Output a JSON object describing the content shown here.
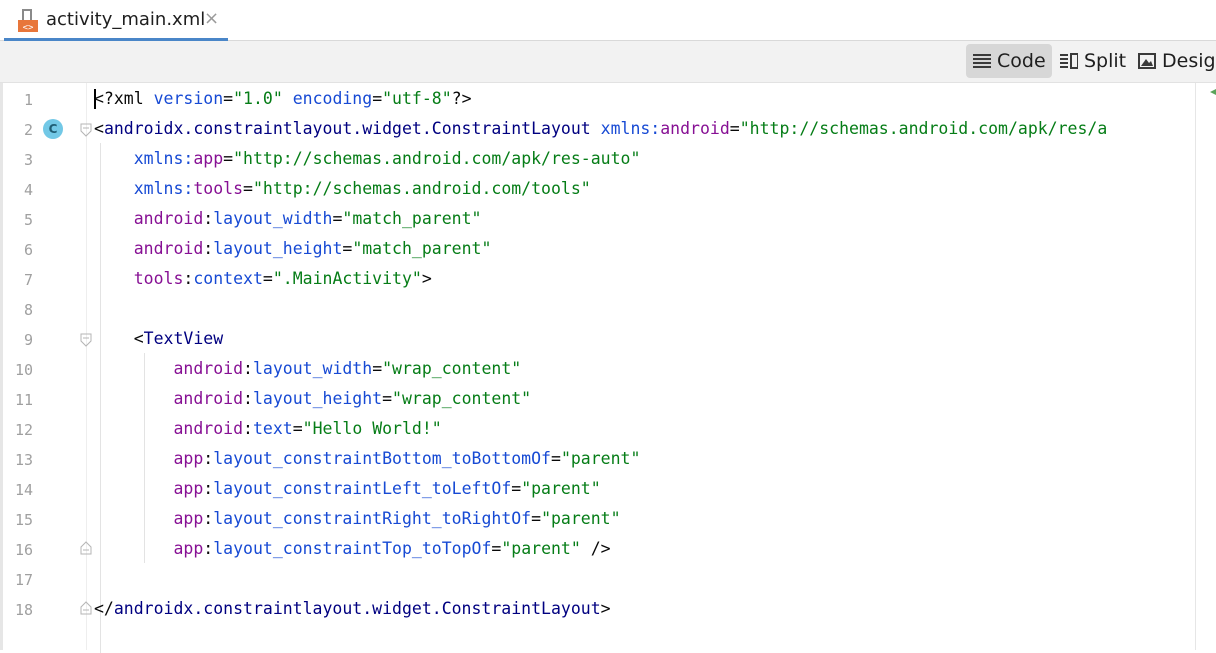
{
  "tab": {
    "file_name": "activity_main.xml",
    "close_glyph": "×",
    "icon": "xml-file-icon"
  },
  "toolbar": {
    "modes": [
      {
        "label": "Code",
        "icon": "code-lines-icon",
        "active": true
      },
      {
        "label": "Split",
        "icon": "split-view-icon",
        "active": false
      },
      {
        "label": "Design",
        "icon": "image-icon",
        "active": false
      }
    ]
  },
  "editor": {
    "gutter_badge": "C",
    "lines": [
      {
        "num": "1",
        "tokens": [
          {
            "t": "plain",
            "s": "<?xml "
          },
          {
            "t": "attr",
            "s": "version"
          },
          {
            "t": "plain",
            "s": "="
          },
          {
            "t": "str",
            "s": "\"1.0\""
          },
          {
            "t": "plain",
            "s": " "
          },
          {
            "t": "attr",
            "s": "encoding"
          },
          {
            "t": "plain",
            "s": "="
          },
          {
            "t": "str",
            "s": "\"utf-8\""
          },
          {
            "t": "plain",
            "s": "?>"
          }
        ]
      },
      {
        "num": "2",
        "tokens": [
          {
            "t": "plain",
            "s": "<"
          },
          {
            "t": "tag",
            "s": "androidx.constraintlayout.widget.ConstraintLayout"
          },
          {
            "t": "plain",
            "s": " "
          },
          {
            "t": "attr",
            "s": "xmlns:"
          },
          {
            "t": "ns",
            "s": "android"
          },
          {
            "t": "plain",
            "s": "="
          },
          {
            "t": "str",
            "s": "\"http://schemas.android.com/apk/res/a"
          }
        ]
      },
      {
        "num": "3",
        "tokens": [
          {
            "t": "plain",
            "s": "    "
          },
          {
            "t": "attr",
            "s": "xmlns:"
          },
          {
            "t": "ns",
            "s": "app"
          },
          {
            "t": "plain",
            "s": "="
          },
          {
            "t": "str",
            "s": "\"http://schemas.android.com/apk/res-auto\""
          }
        ]
      },
      {
        "num": "4",
        "tokens": [
          {
            "t": "plain",
            "s": "    "
          },
          {
            "t": "attr",
            "s": "xmlns:"
          },
          {
            "t": "ns",
            "s": "tools"
          },
          {
            "t": "plain",
            "s": "="
          },
          {
            "t": "str",
            "s": "\"http://schemas.android.com/tools\""
          }
        ]
      },
      {
        "num": "5",
        "tokens": [
          {
            "t": "plain",
            "s": "    "
          },
          {
            "t": "ns",
            "s": "android"
          },
          {
            "t": "plain",
            "s": ":"
          },
          {
            "t": "attr",
            "s": "layout_width"
          },
          {
            "t": "plain",
            "s": "="
          },
          {
            "t": "str",
            "s": "\"match_parent\""
          }
        ]
      },
      {
        "num": "6",
        "tokens": [
          {
            "t": "plain",
            "s": "    "
          },
          {
            "t": "ns",
            "s": "android"
          },
          {
            "t": "plain",
            "s": ":"
          },
          {
            "t": "attr",
            "s": "layout_height"
          },
          {
            "t": "plain",
            "s": "="
          },
          {
            "t": "str",
            "s": "\"match_parent\""
          }
        ]
      },
      {
        "num": "7",
        "tokens": [
          {
            "t": "plain",
            "s": "    "
          },
          {
            "t": "ns",
            "s": "tools"
          },
          {
            "t": "plain",
            "s": ":"
          },
          {
            "t": "attr",
            "s": "context"
          },
          {
            "t": "plain",
            "s": "="
          },
          {
            "t": "str",
            "s": "\".MainActivity\""
          },
          {
            "t": "plain",
            "s": ">"
          }
        ]
      },
      {
        "num": "8",
        "tokens": []
      },
      {
        "num": "9",
        "tokens": [
          {
            "t": "plain",
            "s": "    <"
          },
          {
            "t": "tag",
            "s": "TextView"
          }
        ]
      },
      {
        "num": "10",
        "tokens": [
          {
            "t": "plain",
            "s": "        "
          },
          {
            "t": "ns",
            "s": "android"
          },
          {
            "t": "plain",
            "s": ":"
          },
          {
            "t": "attr",
            "s": "layout_width"
          },
          {
            "t": "plain",
            "s": "="
          },
          {
            "t": "str",
            "s": "\"wrap_content\""
          }
        ]
      },
      {
        "num": "11",
        "tokens": [
          {
            "t": "plain",
            "s": "        "
          },
          {
            "t": "ns",
            "s": "android"
          },
          {
            "t": "plain",
            "s": ":"
          },
          {
            "t": "attr",
            "s": "layout_height"
          },
          {
            "t": "plain",
            "s": "="
          },
          {
            "t": "str",
            "s": "\"wrap_content\""
          }
        ]
      },
      {
        "num": "12",
        "tokens": [
          {
            "t": "plain",
            "s": "        "
          },
          {
            "t": "ns",
            "s": "android"
          },
          {
            "t": "plain",
            "s": ":"
          },
          {
            "t": "attr",
            "s": "text"
          },
          {
            "t": "plain",
            "s": "="
          },
          {
            "t": "str",
            "s": "\"Hello World!\""
          }
        ]
      },
      {
        "num": "13",
        "tokens": [
          {
            "t": "plain",
            "s": "        "
          },
          {
            "t": "ns",
            "s": "app"
          },
          {
            "t": "plain",
            "s": ":"
          },
          {
            "t": "attr",
            "s": "layout_constraintBottom_toBottomOf"
          },
          {
            "t": "plain",
            "s": "="
          },
          {
            "t": "str",
            "s": "\"parent\""
          }
        ]
      },
      {
        "num": "14",
        "tokens": [
          {
            "t": "plain",
            "s": "        "
          },
          {
            "t": "ns",
            "s": "app"
          },
          {
            "t": "plain",
            "s": ":"
          },
          {
            "t": "attr",
            "s": "layout_constraintLeft_toLeftOf"
          },
          {
            "t": "plain",
            "s": "="
          },
          {
            "t": "str",
            "s": "\"parent\""
          }
        ]
      },
      {
        "num": "15",
        "tokens": [
          {
            "t": "plain",
            "s": "        "
          },
          {
            "t": "ns",
            "s": "app"
          },
          {
            "t": "plain",
            "s": ":"
          },
          {
            "t": "attr",
            "s": "layout_constraintRight_toRightOf"
          },
          {
            "t": "plain",
            "s": "="
          },
          {
            "t": "str",
            "s": "\"parent\""
          }
        ]
      },
      {
        "num": "16",
        "tokens": [
          {
            "t": "plain",
            "s": "        "
          },
          {
            "t": "ns",
            "s": "app"
          },
          {
            "t": "plain",
            "s": ":"
          },
          {
            "t": "attr",
            "s": "layout_constraintTop_toTopOf"
          },
          {
            "t": "plain",
            "s": "="
          },
          {
            "t": "str",
            "s": "\"parent\""
          },
          {
            "t": "plain",
            "s": " />"
          }
        ]
      },
      {
        "num": "17",
        "tokens": []
      },
      {
        "num": "18",
        "tokens": [
          {
            "t": "plain",
            "s": "</"
          },
          {
            "t": "tag",
            "s": "androidx.constraintlayout.widget.ConstraintLayout"
          },
          {
            "t": "plain",
            "s": ">"
          }
        ]
      }
    ]
  }
}
